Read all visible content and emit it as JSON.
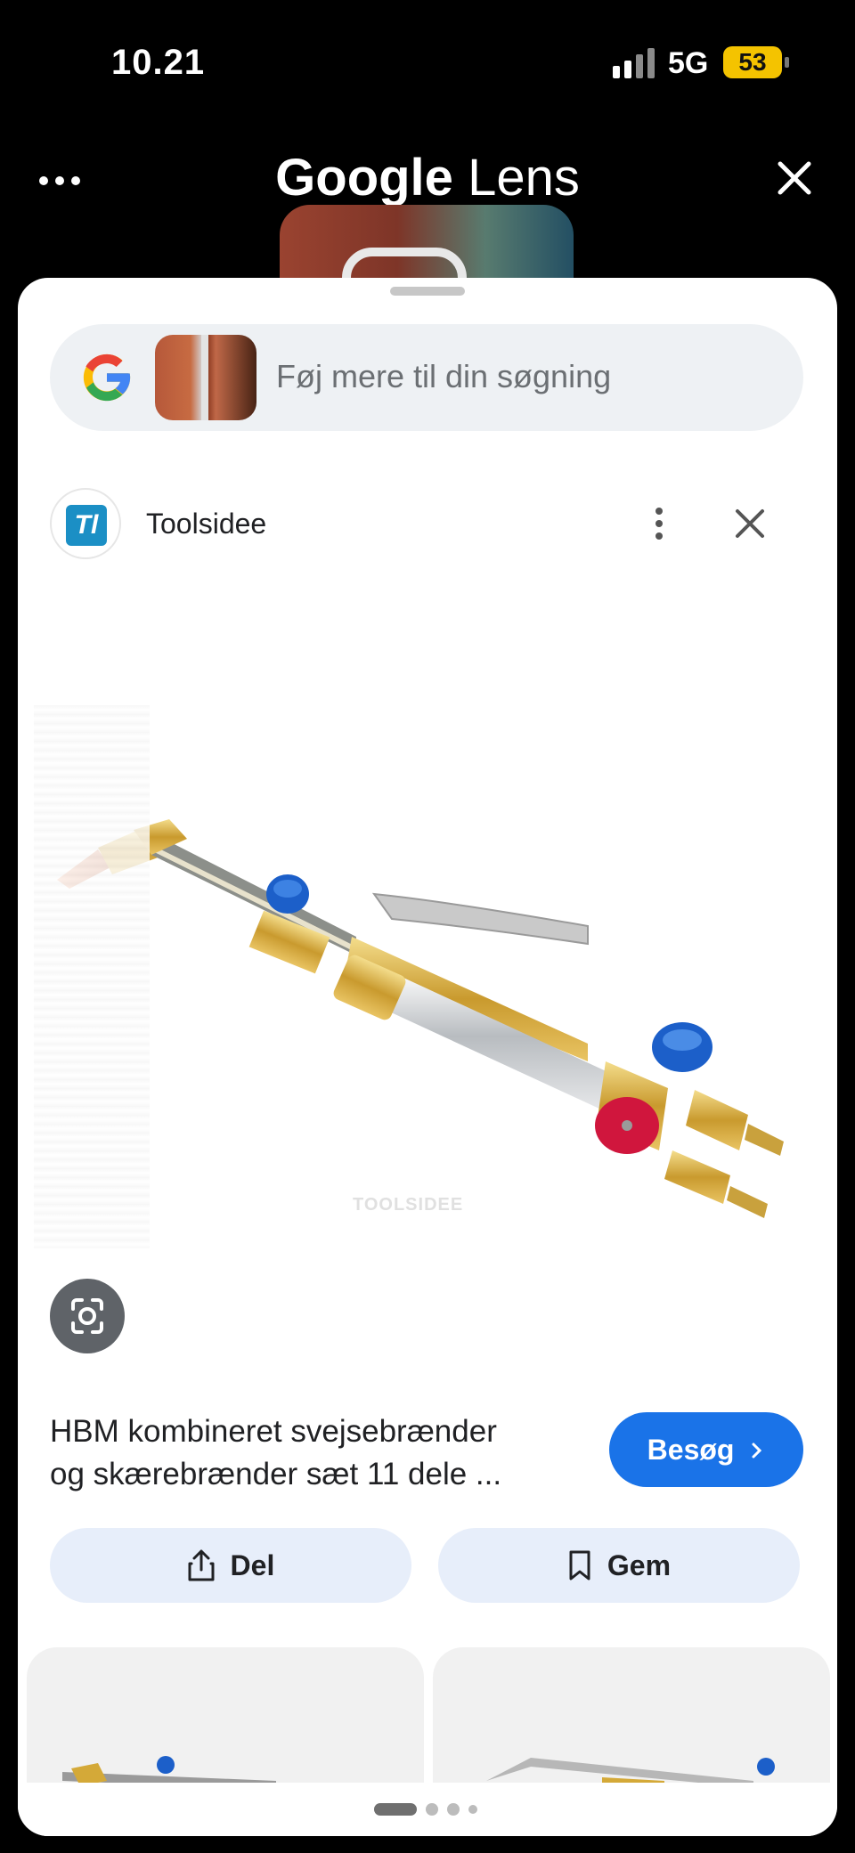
{
  "status_bar": {
    "time": "10.21",
    "network": "5G",
    "battery": "53"
  },
  "top_bar": {
    "title_bold": "Google",
    "title_light": "Lens",
    "icons": [
      "more-horizontal-icon",
      "close-icon"
    ]
  },
  "search": {
    "placeholder": "Føj mere til din søgning",
    "icon": "google-g-icon"
  },
  "source": {
    "logo_text": "Tl",
    "name": "Toolsidee",
    "icons": [
      "more-vertical-icon",
      "close-icon"
    ]
  },
  "product": {
    "image_watermark": "TOOLSIDEE",
    "title_line1": "HBM kombineret svejsebrænder",
    "title_line2": "og skærebrænder sæt 11 dele ...",
    "visit_label": "Besøg",
    "share_label": "Del",
    "save_label": "Gem"
  },
  "pager": {
    "active_index": 0,
    "count": 4
  },
  "colors": {
    "accent": "#1a73e8",
    "chip": "#e7eefa",
    "battery": "#f4c300",
    "handle_red": "#d0163d",
    "valve_blue": "#1c5fc9",
    "brass": "#d8b24a"
  }
}
